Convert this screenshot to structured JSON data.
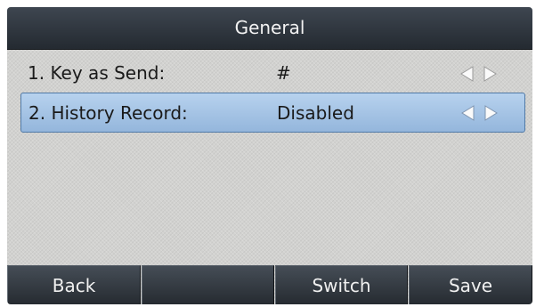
{
  "title": "General",
  "rows": [
    {
      "label": "1. Key as Send:",
      "value": "#"
    },
    {
      "label": "2. History Record:",
      "value": "Disabled"
    }
  ],
  "softkeys": [
    "Back",
    "",
    "Switch",
    "Save"
  ],
  "colors": {
    "selected_row": "#a9c6e8",
    "title_bar": "#2f363e",
    "arrow": "#fafafa"
  }
}
